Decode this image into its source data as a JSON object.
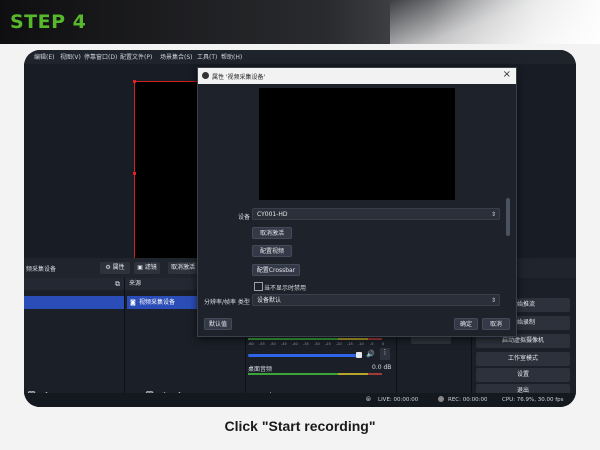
{
  "header": {
    "step": "STEP 4"
  },
  "menubar": {
    "items": [
      "编辑(E)",
      "视图(V)",
      "停靠窗口(D)",
      "配置文件(P)",
      "场景集合(S)",
      "工具(T)",
      "帮助(H)"
    ]
  },
  "toolbar": {
    "source_label": "频采集设备",
    "properties": "属性",
    "filters": "滤镜",
    "deactivate": "取消激活"
  },
  "sources": {
    "header": "来源",
    "item": "视频采集设备"
  },
  "mixer": {
    "ticks": [
      "-60",
      "-55",
      "-50",
      "-45",
      "-40",
      "-35",
      "-30",
      "-25",
      "-20",
      "-15",
      "-10",
      "-5",
      "0"
    ],
    "track_name": "桌面音频",
    "track_level": "0.0 dB"
  },
  "controls": {
    "start_streaming": "开始推流",
    "start_recording": "开始录制",
    "virtual_camera": "启动虚拟摄像机",
    "studio_mode": "工作室模式",
    "settings": "设置",
    "exit": "退出"
  },
  "status": {
    "live": "LIVE: 00:00:00",
    "rec": "REC: 00:00:00",
    "cpu": "CPU: 76.9%, 30.00 fps"
  },
  "dialog": {
    "title": "属性 '视频采集设备'",
    "device_label": "设备",
    "device_value": "CY001-HD",
    "btn_deactivate": "取消激活",
    "btn_configure_video": "配置视频",
    "btn_configure_crossbar": "配置Crossbar",
    "checkbox_label": "当不显示时禁用",
    "resolution_label": "分辨率/帧率 类型",
    "resolution_value": "设备默认",
    "defaults": "默认值",
    "ok": "确定",
    "cancel": "取消"
  },
  "caption": "Click \"Start recording\""
}
